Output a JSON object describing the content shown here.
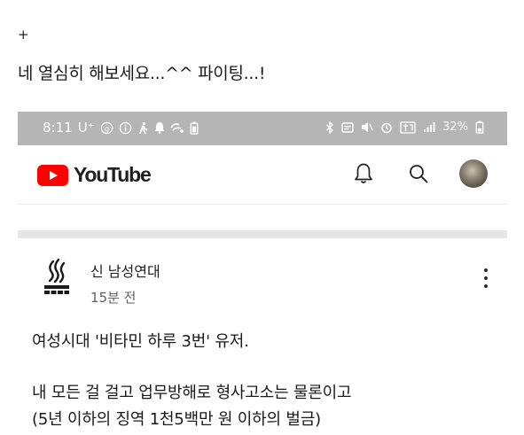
{
  "caption": {
    "plus": "+",
    "text": "네 열심히 해보세요...^^ 파이팅...!"
  },
  "statusbar": {
    "time": "8:11",
    "carrier": "U⁺",
    "battery": "32%",
    "background": "#b5b5b5"
  },
  "app": {
    "logo_text": "YouTube",
    "brand_color": "#ff0000",
    "icons": [
      "bell-icon",
      "search-icon",
      "avatar"
    ]
  },
  "post": {
    "channel_name": "신 남성연대",
    "time_ago": "15분 전",
    "lines": [
      "여성시대 '비타민 하루 3번' 유저.",
      "내 모든 걸 걸고 업무방해로 형사고소는 물론이고",
      "(5년 이하의 징역 1천5백만 원 이하의 벌금)"
    ]
  }
}
